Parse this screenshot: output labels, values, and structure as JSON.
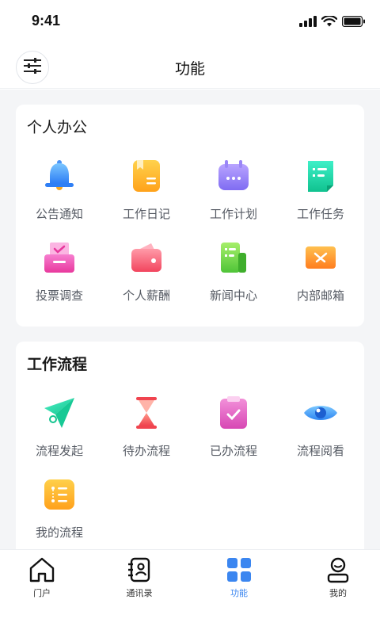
{
  "status_bar": {
    "time": "9:41"
  },
  "nav": {
    "title": "功能",
    "menu_icon": "sliders-icon"
  },
  "sections": {
    "personal": {
      "title": "个人办公",
      "items": [
        {
          "label": "公告通知",
          "icon": "bell-icon"
        },
        {
          "label": "工作日记",
          "icon": "diary-icon"
        },
        {
          "label": "工作计划",
          "icon": "calendar-icon"
        },
        {
          "label": "工作任务",
          "icon": "task-icon"
        },
        {
          "label": "投票调查",
          "icon": "vote-icon"
        },
        {
          "label": "个人薪酬",
          "icon": "wallet-icon"
        },
        {
          "label": "新闻中心",
          "icon": "news-icon"
        },
        {
          "label": "内部邮箱",
          "icon": "mail-icon"
        }
      ]
    },
    "workflow": {
      "title": "工作流程",
      "items": [
        {
          "label": "流程发起",
          "icon": "paper-plane-icon"
        },
        {
          "label": "待办流程",
          "icon": "hourglass-icon"
        },
        {
          "label": "已办流程",
          "icon": "clipboard-check-icon"
        },
        {
          "label": "流程阅看",
          "icon": "eye-icon"
        },
        {
          "label": "我的流程",
          "icon": "flow-list-icon"
        }
      ]
    }
  },
  "tabbar": {
    "tabs": [
      {
        "label": "门户",
        "icon": "home-icon",
        "active": false
      },
      {
        "label": "通讯录",
        "icon": "contacts-icon",
        "active": false
      },
      {
        "label": "功能",
        "icon": "grid-icon",
        "active": true
      },
      {
        "label": "我的",
        "icon": "user-icon",
        "active": false
      }
    ]
  },
  "colors": {
    "accent": "#3b86f0",
    "background": "#f4f5f7",
    "card": "#ffffff"
  }
}
